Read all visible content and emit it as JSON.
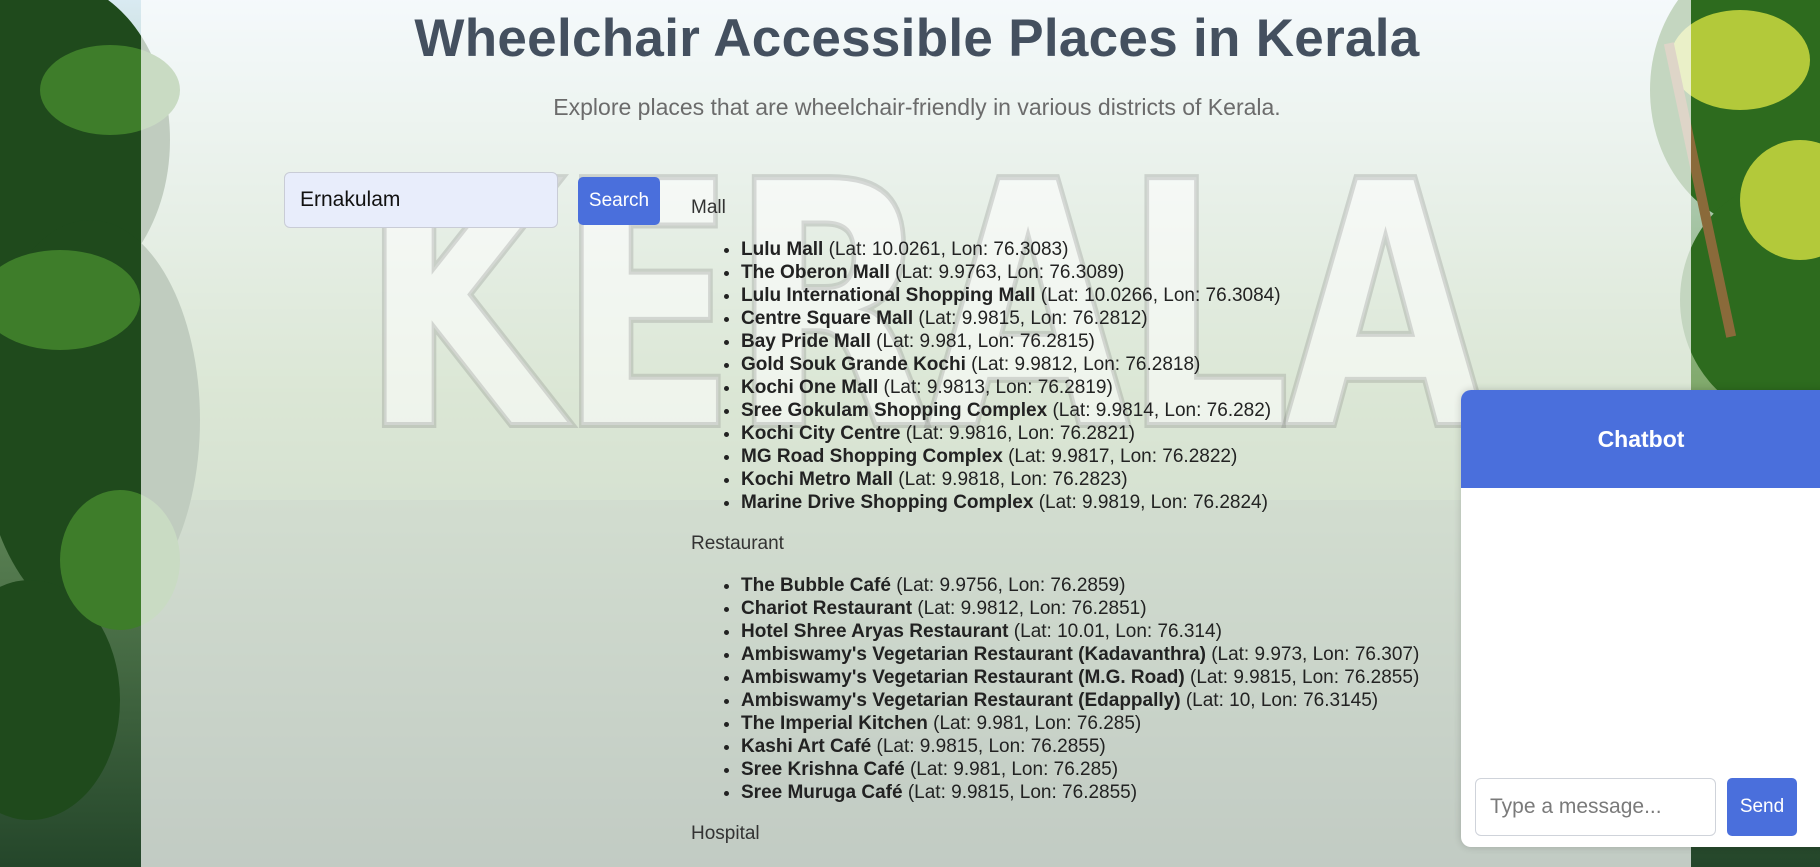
{
  "header": {
    "title": "Wheelchair Accessible Places in Kerala",
    "subtitle": "Explore places that are wheelchair-friendly in various districts of Kerala."
  },
  "search": {
    "value": "Ernakulam",
    "button_label": "Search"
  },
  "results": {
    "categories": [
      {
        "name": "Mall",
        "places": [
          {
            "name": "Lulu Mall",
            "coords": "(Lat: 10.0261, Lon: 76.3083)"
          },
          {
            "name": "The Oberon Mall",
            "coords": "(Lat: 9.9763, Lon: 76.3089)"
          },
          {
            "name": "Lulu International Shopping Mall",
            "coords": "(Lat: 10.0266, Lon: 76.3084)"
          },
          {
            "name": "Centre Square Mall",
            "coords": "(Lat: 9.9815, Lon: 76.2812)"
          },
          {
            "name": "Bay Pride Mall",
            "coords": "(Lat: 9.981, Lon: 76.2815)"
          },
          {
            "name": "Gold Souk Grande Kochi",
            "coords": "(Lat: 9.9812, Lon: 76.2818)"
          },
          {
            "name": "Kochi One Mall",
            "coords": "(Lat: 9.9813, Lon: 76.2819)"
          },
          {
            "name": "Sree Gokulam Shopping Complex",
            "coords": "(Lat: 9.9814, Lon: 76.282)"
          },
          {
            "name": "Kochi City Centre",
            "coords": "(Lat: 9.9816, Lon: 76.2821)"
          },
          {
            "name": "MG Road Shopping Complex",
            "coords": "(Lat: 9.9817, Lon: 76.2822)"
          },
          {
            "name": "Kochi Metro Mall",
            "coords": "(Lat: 9.9818, Lon: 76.2823)"
          },
          {
            "name": "Marine Drive Shopping Complex",
            "coords": "(Lat: 9.9819, Lon: 76.2824)"
          }
        ]
      },
      {
        "name": "Restaurant",
        "places": [
          {
            "name": "The Bubble Café",
            "coords": "(Lat: 9.9756, Lon: 76.2859)"
          },
          {
            "name": "Chariot Restaurant",
            "coords": "(Lat: 9.9812, Lon: 76.2851)"
          },
          {
            "name": "Hotel Shree Aryas Restaurant",
            "coords": "(Lat: 10.01, Lon: 76.314)"
          },
          {
            "name": "Ambiswamy's Vegetarian Restaurant (Kadavanthra)",
            "coords": "(Lat: 9.973, Lon: 76.307)"
          },
          {
            "name": "Ambiswamy's Vegetarian Restaurant (M.G. Road)",
            "coords": "(Lat: 9.9815, Lon: 76.2855)"
          },
          {
            "name": "Ambiswamy's Vegetarian Restaurant (Edappally)",
            "coords": "(Lat: 10, Lon: 76.3145)"
          },
          {
            "name": "The Imperial Kitchen",
            "coords": "(Lat: 9.981, Lon: 76.285)"
          },
          {
            "name": "Kashi Art Café",
            "coords": "(Lat: 9.9815, Lon: 76.2855)"
          },
          {
            "name": "Sree Krishna Café",
            "coords": "(Lat: 9.981, Lon: 76.285)"
          },
          {
            "name": "Sree Muruga Café",
            "coords": "(Lat: 9.9815, Lon: 76.2855)"
          }
        ]
      },
      {
        "name": "Hospital",
        "places": []
      }
    ]
  },
  "chatbot": {
    "title": "Chatbot",
    "input_placeholder": "Type a message...",
    "send_label": "Send"
  },
  "colors": {
    "accent": "#4a6fdc",
    "title": "#44505f",
    "search_field_bg": "#e8edfb"
  },
  "background": {
    "watermark_text": "KERALA"
  }
}
